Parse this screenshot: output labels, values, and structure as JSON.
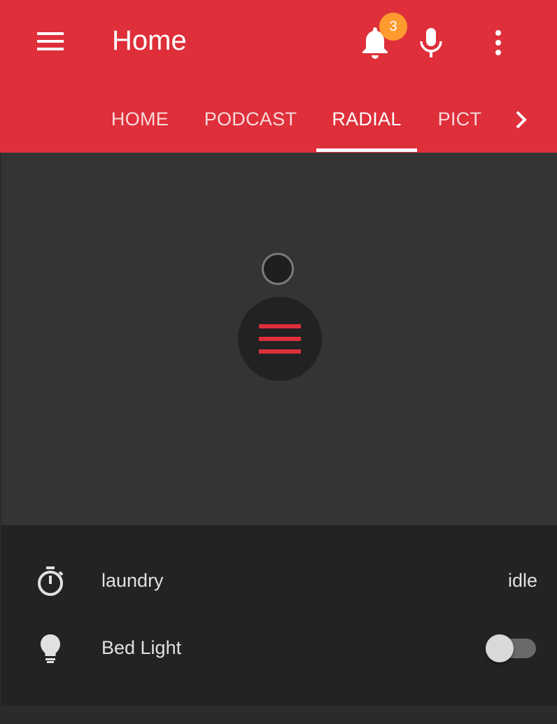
{
  "colors": {
    "header": "#de2f3a",
    "badge": "#ff9a2e",
    "radial_bg": "#343434",
    "card_bg": "#232323",
    "accent": "#de2f3a"
  },
  "header": {
    "title": "Home",
    "menu_icon": "hamburger-menu-icon",
    "notifications": {
      "icon": "bell-icon",
      "count": "3"
    },
    "mic_icon": "microphone-icon",
    "more_icon": "more-vertical-icon"
  },
  "tabs": {
    "items": [
      {
        "label": "HOME"
      },
      {
        "label": "PODCAST"
      },
      {
        "label": "RADIAL"
      },
      {
        "label": "PICT"
      }
    ],
    "active": "RADIAL",
    "next_icon": "chevron-right-icon"
  },
  "radial": {
    "button_icon": "radial-menu-icon"
  },
  "entities": [
    {
      "icon": "timer-icon",
      "label": "laundry",
      "state": "idle"
    },
    {
      "icon": "lightbulb-icon",
      "label": "Bed Light",
      "toggle_on": false
    }
  ]
}
